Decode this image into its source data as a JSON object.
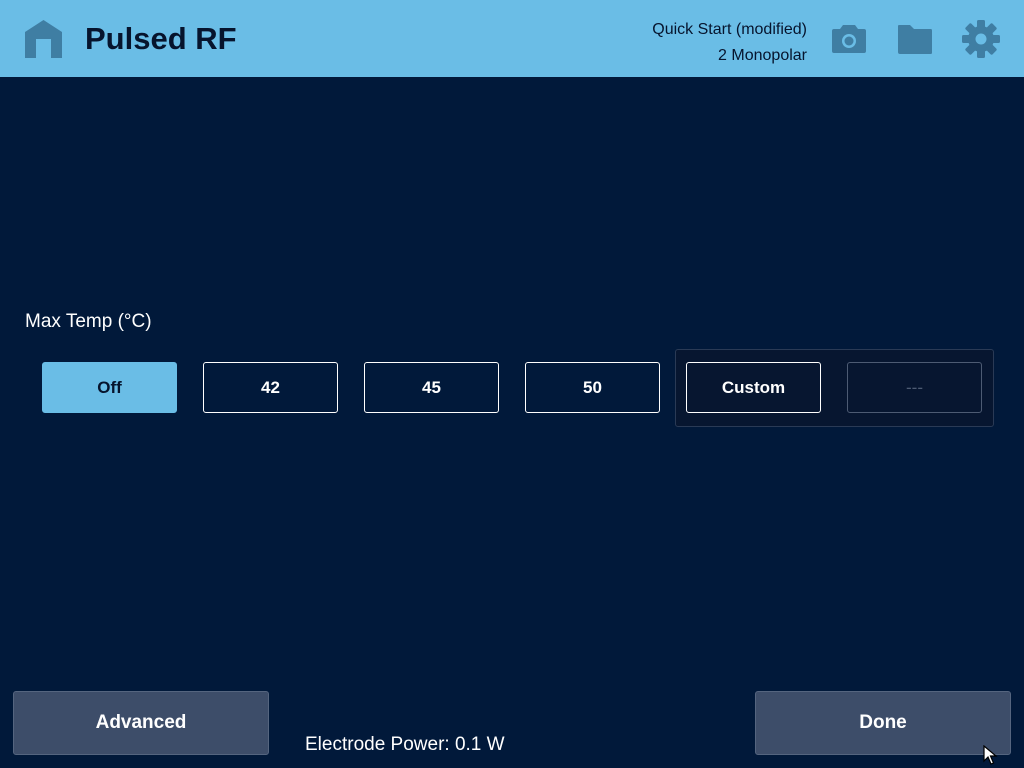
{
  "header": {
    "title": "Pulsed RF",
    "preset_name": "Quick Start (modified)",
    "mode": "2 Monopolar",
    "icons": [
      "home-icon",
      "camera-icon",
      "folder-icon",
      "gear-icon"
    ]
  },
  "max_temp": {
    "label": "Max Temp (°C)",
    "options": [
      "Off",
      "42",
      "45",
      "50"
    ],
    "selected": "Off",
    "custom_label": "Custom",
    "custom_value": "---"
  },
  "footer": {
    "advanced_label": "Advanced",
    "done_label": "Done",
    "power_readout": "Electrode Power: 0.1 W"
  },
  "colors": {
    "background": "#01193a",
    "header": "#6abde6",
    "selected": "#6abde6",
    "button": "#3d4d69"
  }
}
